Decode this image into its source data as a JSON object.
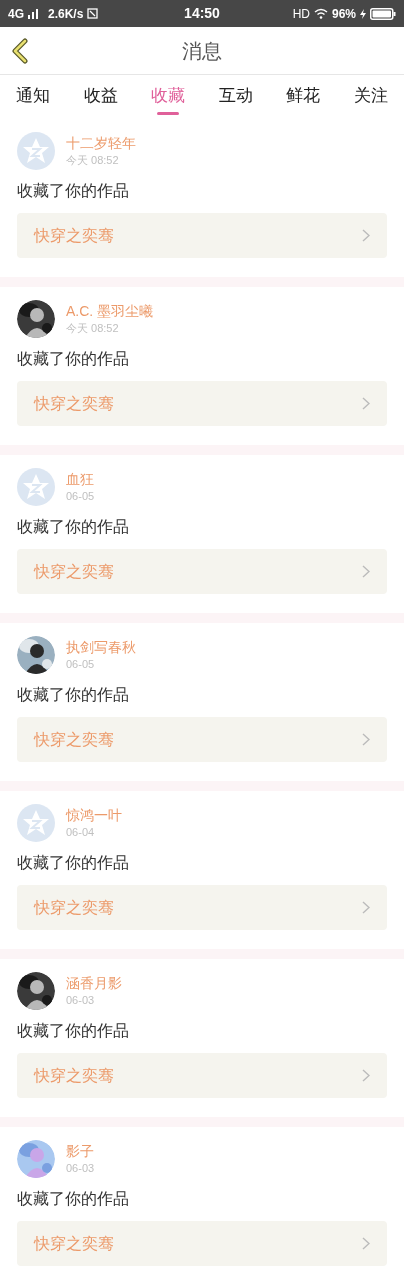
{
  "status_bar": {
    "network": "4G",
    "speed": "2.6K/s",
    "time": "14:50",
    "hd": "HD",
    "battery": "96%"
  },
  "header": {
    "title": "消息"
  },
  "tabs": [
    {
      "label": "通知",
      "selected": false
    },
    {
      "label": "收益",
      "selected": false
    },
    {
      "label": "收藏",
      "selected": true
    },
    {
      "label": "互动",
      "selected": false
    },
    {
      "label": "鲜花",
      "selected": false
    },
    {
      "label": "关注",
      "selected": false
    }
  ],
  "messages": [
    {
      "user": "十二岁轻年",
      "time": "今天 08:52",
      "avatar": {
        "kind": "default"
      },
      "text": "收藏了你的作品",
      "work": "快穿之奕骞"
    },
    {
      "user": "A.C. 墨羽尘曦",
      "time": "今天 08:52",
      "text": "收藏了你的作品",
      "work": "快穿之奕骞"
    },
    {
      "user": "血狂",
      "time": "06-05",
      "avatar": {
        "kind": "default"
      },
      "text": "收藏了你的作品",
      "work": "快穿之奕骞"
    },
    {
      "user": "执剑写春秋",
      "time": "06-05",
      "text": "收藏了你的作品",
      "work": "快穿之奕骞"
    },
    {
      "user": "惊鸿一叶",
      "time": "06-04",
      "avatar": {
        "kind": "default"
      },
      "text": "收藏了你的作品",
      "work": "快穿之奕骞"
    },
    {
      "user": "涵香月影",
      "time": "06-03",
      "text": "收藏了你的作品",
      "work": "快穿之奕骞"
    },
    {
      "user": "影子",
      "time": "06-03",
      "text": "收藏了你的作品",
      "work": "快穿之奕骞"
    }
  ]
}
